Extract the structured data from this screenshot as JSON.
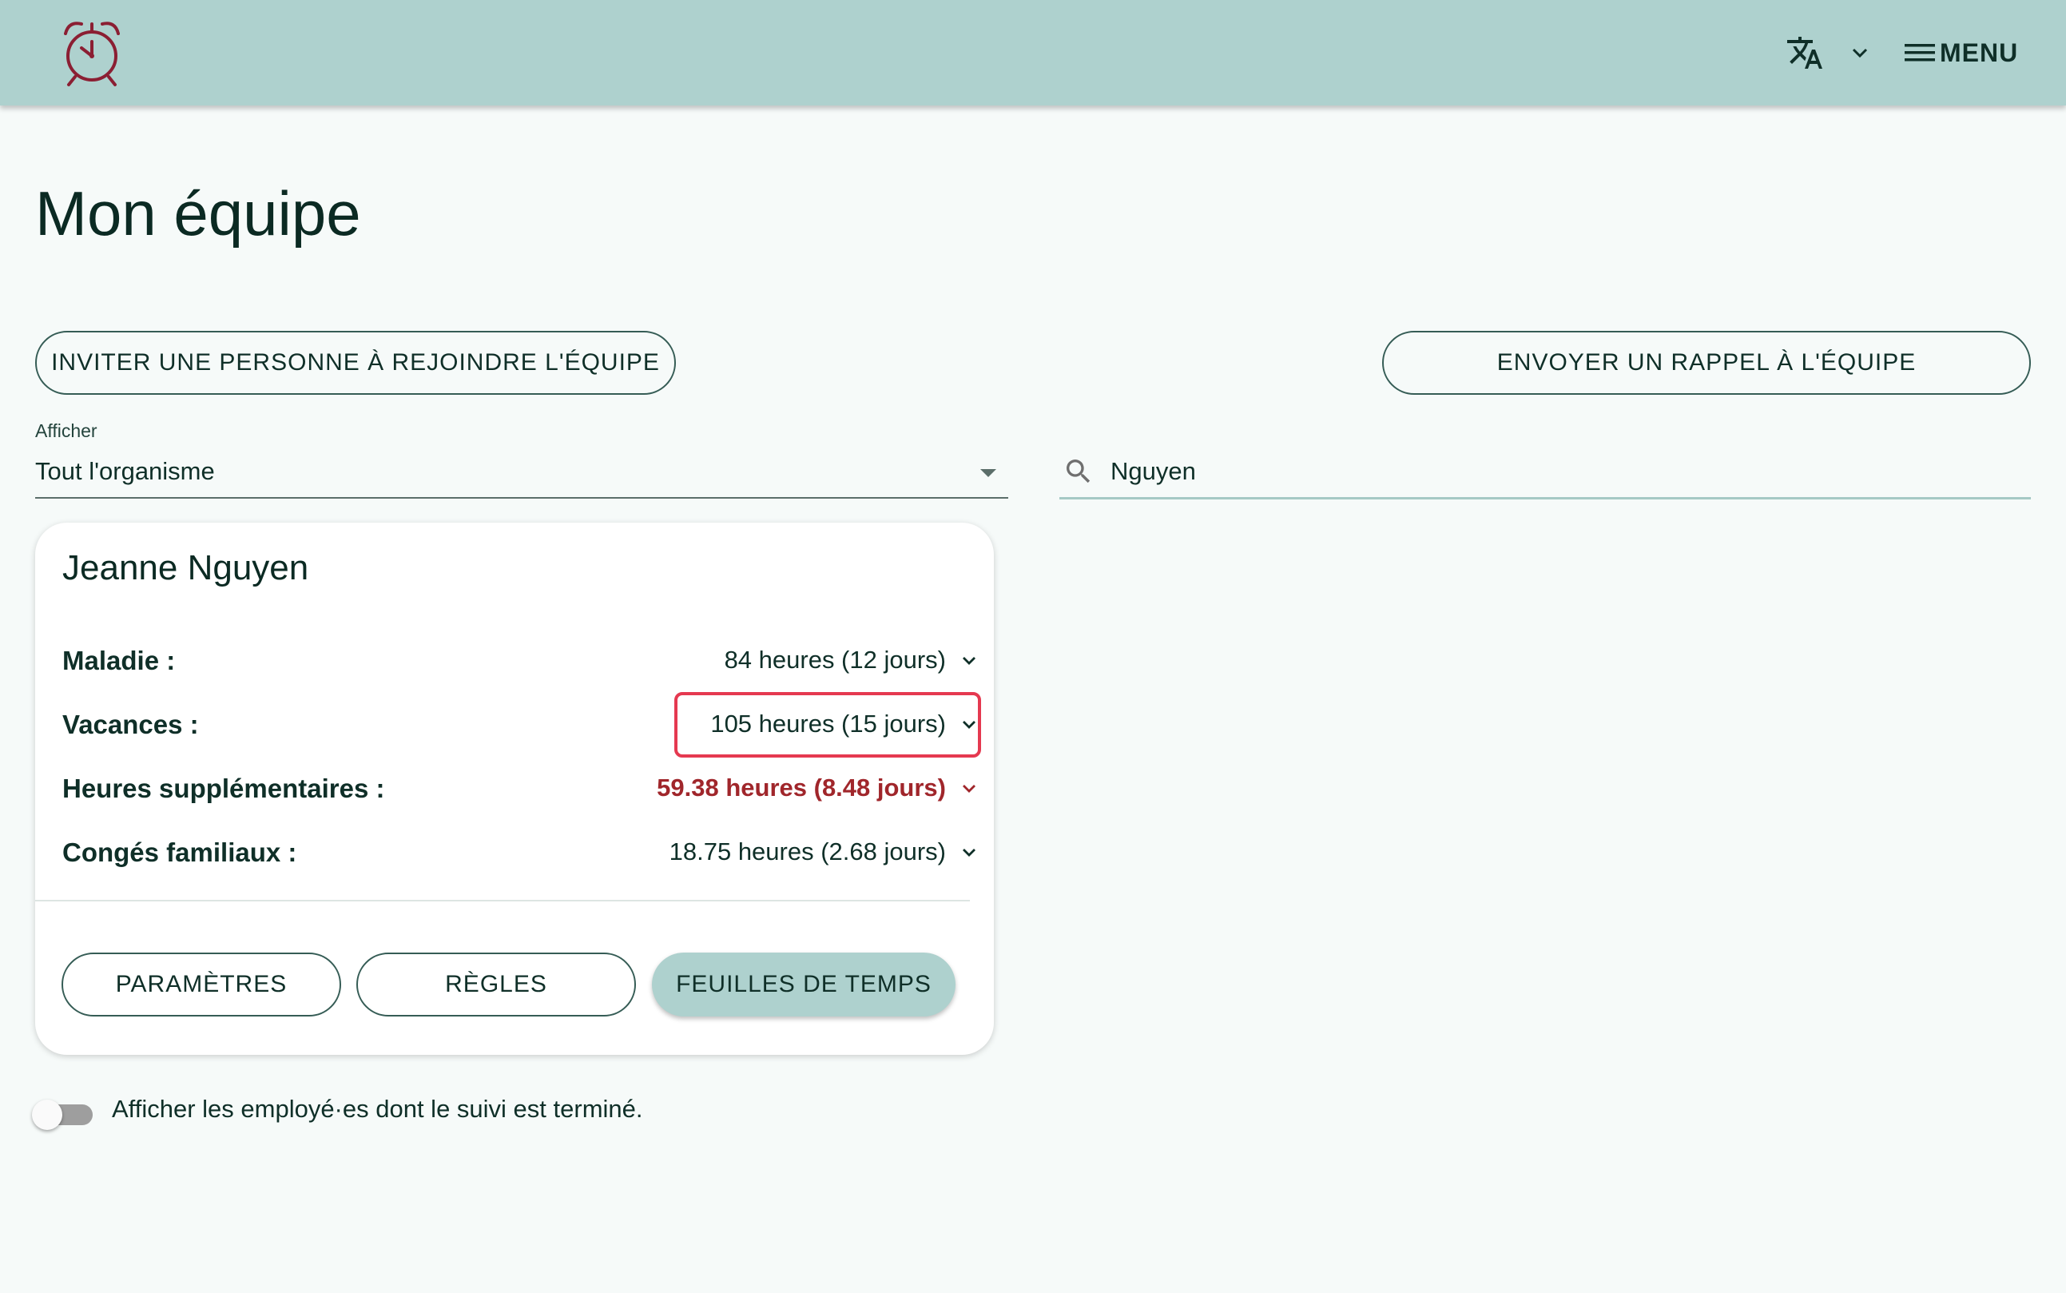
{
  "header": {
    "logo_icon": "alarm-clock-icon",
    "language_icon": "translate-icon",
    "menu_label": "MENU",
    "brand_color": "#aed1ce",
    "logo_color": "#8b1f33"
  },
  "page": {
    "title": "Mon équipe"
  },
  "actions": {
    "invite_label": "INVITER UNE PERSONNE À REJOINDRE L'ÉQUIPE",
    "remind_label": "ENVOYER UN RAPPEL À L'ÉQUIPE"
  },
  "filter": {
    "label": "Afficher",
    "value": "Tout l'organisme"
  },
  "search": {
    "value": "Nguyen",
    "icon": "search-icon"
  },
  "employee": {
    "name": "Jeanne Nguyen",
    "rows": [
      {
        "label": "Maladie :",
        "value": "84 heures (12 jours)"
      },
      {
        "label": "Vacances :",
        "value": "105 heures (15 jours)"
      },
      {
        "label": "Heures supplémentaires :",
        "value": "59.38 heures (8.48 jours)"
      },
      {
        "label": "Congés familiaux :",
        "value": "18.75 heures (2.68 jours)"
      }
    ],
    "buttons": {
      "settings": "PARAMÈTRES",
      "rules": "RÈGLES",
      "timesheets": "FEUILLES DE TEMPS"
    },
    "negative_color": "#a0262b",
    "highlight_color": "#e53950"
  },
  "toggle": {
    "label": "Afficher les employé·es dont le suivi est terminé.",
    "checked": false
  }
}
